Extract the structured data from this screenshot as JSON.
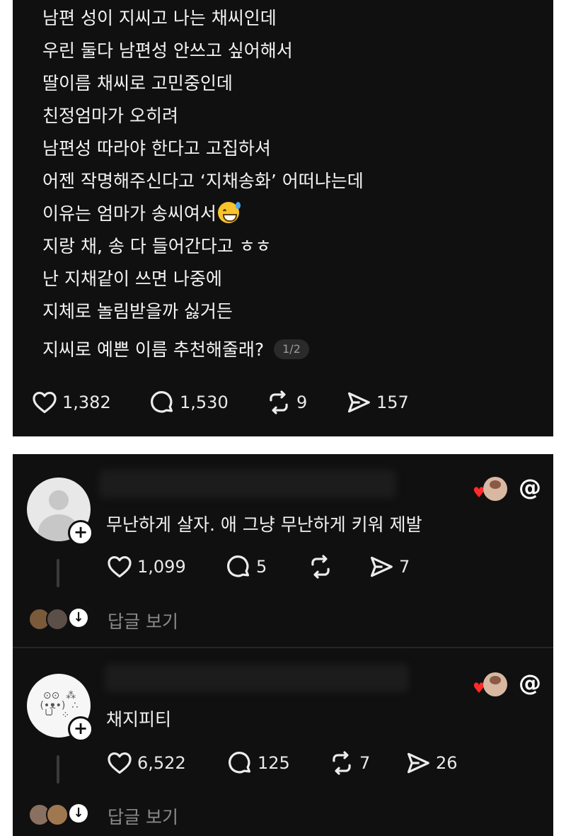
{
  "post": {
    "lines": [
      "남편 성이 지씨고 나는 채씨인데",
      "우린 둘다 남편성 안쓰고 싶어해서",
      "딸이름 채씨로 고민중인데",
      "친정엄마가 오히려",
      "남편성 따라야 한다고 고집하셔",
      "어젠 작명해주신다고 ‘지채송화’ 어떠냐는데",
      "이유는 엄마가 송씨여서",
      "지랑 채, 송 다 들어간다고 ㅎㅎ",
      "난 지채같이 쓰면 나중에",
      "지체로 놀림받을까 싫거든",
      "지씨로 예쁜 이름 추천해줄래?"
    ],
    "emoji_icon": "grinning-sweat-emoji",
    "page_indicator": "1/2",
    "likes": "1,382",
    "comments": "1,530",
    "reposts": "9",
    "shares": "157"
  },
  "replies": [
    {
      "text": "무난하게 살자. 애 그냥 무난하게 키워 제발",
      "likes": "1,099",
      "comments": "5",
      "reposts": "",
      "shares": "7",
      "view_replies": "답글 보기",
      "avatar_icon": "default-avatar"
    },
    {
      "text": "채지피티",
      "likes": "6,522",
      "comments": "125",
      "reposts": "7",
      "shares": "26",
      "view_replies": "답글 보기",
      "avatar_icon": "doodle-avatar"
    }
  ],
  "icons": {
    "heart": "heart-icon",
    "comment": "comment-icon",
    "repost": "repost-icon",
    "share": "share-icon",
    "threads": "threads-logo-icon",
    "follow": "plus-icon",
    "expand": "arrow-down-icon"
  },
  "colors": {
    "card_bg": "#101010",
    "text": "#f4f4f4",
    "muted": "#8a8a8a",
    "heart_badge": "#ff2a2a"
  }
}
